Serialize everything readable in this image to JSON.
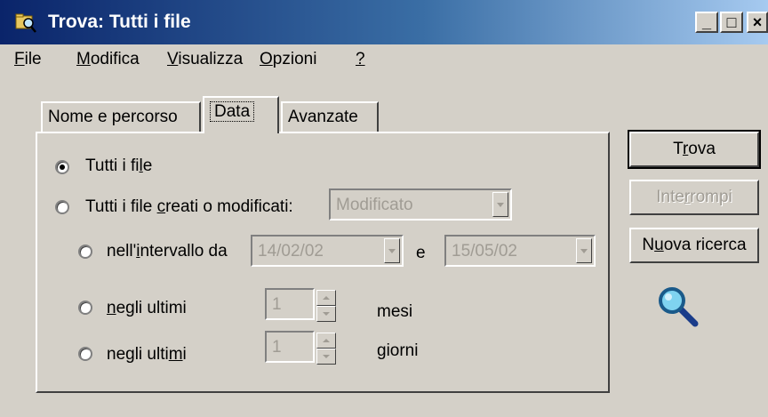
{
  "window": {
    "title": "Trova: Tutti i file",
    "min_glyph": "_",
    "max_glyph": "□",
    "close_glyph": "×"
  },
  "menu": [
    {
      "pre": "",
      "u": "F",
      "post": "ile"
    },
    {
      "pre": "",
      "u": "M",
      "post": "odifica"
    },
    {
      "pre": "",
      "u": "V",
      "post": "isualizza"
    },
    {
      "pre": "",
      "u": "O",
      "post": "pzioni"
    },
    {
      "pre": "",
      "u": "?",
      "post": ""
    }
  ],
  "tabs": {
    "nome": "Nome e percorso",
    "data": "Data",
    "avanzate": "Avanzate",
    "selected": "Data"
  },
  "options": {
    "tutti": {
      "pre": "Tutti i fi",
      "u": "l",
      "post": "e",
      "checked": true
    },
    "creati": {
      "pre": "Tutti i file ",
      "u": "c",
      "post": "reati o modificati:",
      "checked": false
    },
    "creati_combo": "Modificato",
    "intervallo": {
      "pre": "nell'",
      "u": "i",
      "post": "ntervallo da",
      "checked": false
    },
    "date_from": "14/02/02",
    "date_sep": "e",
    "date_to": "15/05/02",
    "mesi": {
      "pre": "",
      "u": "n",
      "post": "egli ultimi",
      "checked": false
    },
    "mesi_value": "1",
    "mesi_unit": "mesi",
    "giorni": {
      "pre": "negli ulti",
      "u": "m",
      "post": "i",
      "checked": false
    },
    "giorni_value": "1",
    "giorni_unit": "giorni"
  },
  "buttons": {
    "trova": {
      "pre": "T",
      "u": "r",
      "post": "ova"
    },
    "interrompi": {
      "pre": "Inte",
      "u": "r",
      "post": "rompi",
      "disabled": true
    },
    "nuova": {
      "pre": "N",
      "u": "u",
      "post": "ova ricerca"
    }
  },
  "icons": {
    "title": "search-folder-icon",
    "search": "magnifier-icon"
  },
  "colors": {
    "titlebar_start": "#0a246a",
    "titlebar_end": "#a6caf0",
    "face": "#d4d0c8",
    "disabled_text": "#a09c94"
  }
}
